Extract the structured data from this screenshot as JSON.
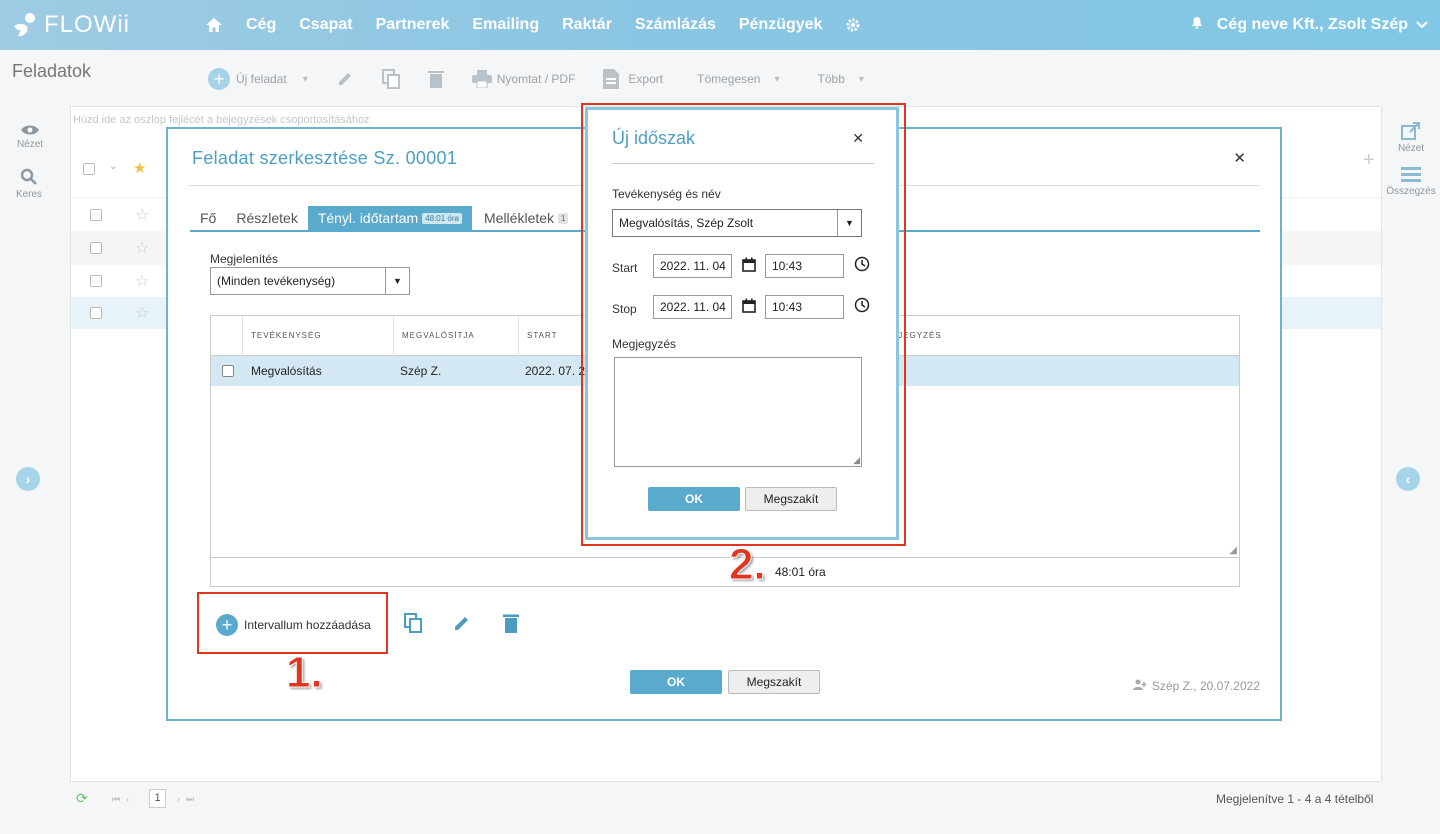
{
  "app": {
    "logo_text": "FLOWii"
  },
  "nav": {
    "items": [
      "Cég",
      "Csapat",
      "Partnerek",
      "Emailing",
      "Raktár",
      "Számlázás",
      "Pénzügyek"
    ],
    "account": "Cég neve Kft., Zsolt Szép"
  },
  "page": {
    "title": "Feladatok"
  },
  "toolbar": {
    "new_task": "Új feladat",
    "print": "Nyomtat / PDF",
    "export": "Export",
    "bulk": "Tömegesen",
    "more": "Több"
  },
  "left_rail": {
    "view": "Nézet",
    "search": "Keres"
  },
  "right_rail": {
    "view": "Nézet",
    "summary": "Összegzés"
  },
  "grid": {
    "group_hint": "Húzd ide az oszlop fejlécét a bejegyzések csoportosításához"
  },
  "pager": {
    "page": "1",
    "status": "Megjelenítve 1 - 4 a 4 tételből"
  },
  "modal": {
    "title": "Feladat szerkesztése Sz. 00001",
    "tabs": {
      "main": "Fő",
      "details": "Részletek",
      "actual_duration": "Tényl. időtartam",
      "actual_duration_badge": "48:01 óra",
      "attachments": "Mellékletek",
      "attachments_badge": "1"
    },
    "display_label": "Megjelenítés",
    "display_value": "(Minden tevékenység)",
    "table": {
      "headers": {
        "activity": "TEVÉKENYSÉG",
        "performer": "MEGVALÓSÍTJA",
        "start": "START",
        "note": "MEGJEGYZÉS"
      },
      "row": {
        "activity": "Megvalósítás",
        "performer": "Szép Z.",
        "start": "2022. 07. 20"
      },
      "total": "48:01 óra"
    },
    "add_interval": "Intervallum hozzáadása",
    "ok": "OK",
    "cancel": "Megszakít",
    "footer_meta": "Szép Z., 20.07.2022"
  },
  "dialog": {
    "title": "Új időszak",
    "activity_label": "Tevékenység és név",
    "activity_value": "Megvalósítás, Szép Zsolt",
    "start_label": "Start",
    "start_date": "2022. 11. 04",
    "start_time": "10:43",
    "stop_label": "Stop",
    "stop_date": "2022. 11. 04",
    "stop_time": "10:43",
    "note_label": "Megjegyzés",
    "ok": "OK",
    "cancel": "Megszakít"
  },
  "annotations": {
    "step1": "1.",
    "step2": "2."
  },
  "colors": {
    "accent": "#5aaacd",
    "nav_gradient_start": "#9ecbe3",
    "highlight_red": "#e0361f",
    "row_selected": "#d4e8f4"
  }
}
